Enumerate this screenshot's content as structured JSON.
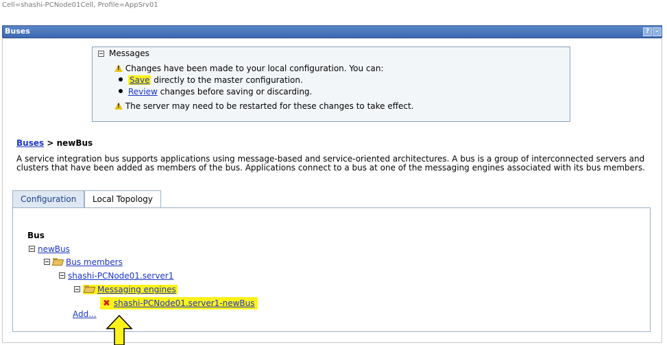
{
  "header": {
    "cell_profile": "Cell=shashi-PCNode01Cell, Profile=AppSrv01"
  },
  "titlebar": {
    "title": "Buses",
    "help_label": "?",
    "minimize_label": "–"
  },
  "messages": {
    "title": "Messages",
    "line1": "Changes have been made to your local configuration. You can:",
    "save_link": "Save",
    "save_text": "directly to the master configuration.",
    "review_link": "Review",
    "review_text": "changes before saving or discarding.",
    "line4": "The server may need to be restarted for these changes to take effect."
  },
  "breadcrumb": {
    "parent": "Buses",
    "separator": ">",
    "current": "newBus"
  },
  "description": "A service integration bus supports applications using message-based and service-oriented architectures. A bus is a group of interconnected servers and clusters that have been added as members of the bus. Applications connect to a bus at one of the messaging engines associated with its bus members.",
  "tabs": [
    {
      "label": "Configuration"
    },
    {
      "label": "Local Topology"
    }
  ],
  "topology": {
    "heading": "Bus",
    "bus": "newBus",
    "members_folder": "Bus members",
    "server": "shashi-PCNode01.server1",
    "engines_folder": "Messaging engines",
    "engine": "shashi-PCNode01.server1-newBus",
    "add_link": "Add..."
  },
  "colors": {
    "titlebar": "#3d68b0",
    "highlight": "#fff21a",
    "link": "#1a34c8",
    "error": "#d81a1a"
  }
}
